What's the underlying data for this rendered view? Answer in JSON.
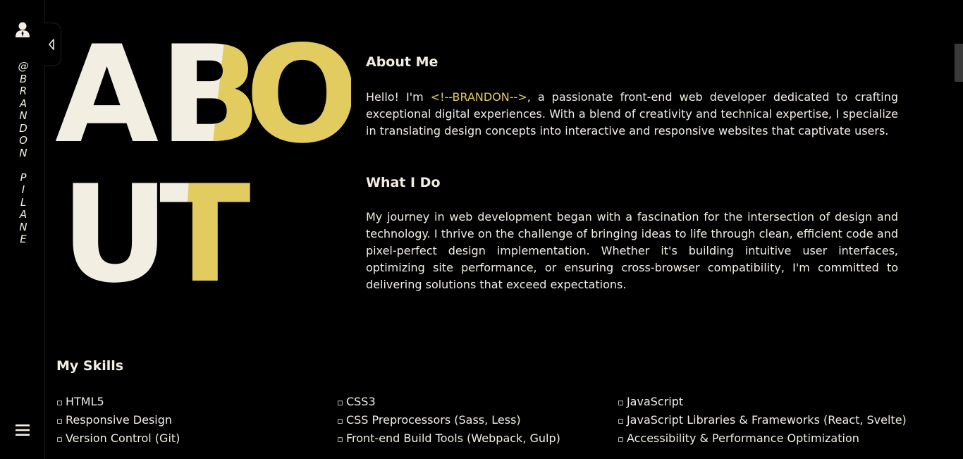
{
  "sidebar": {
    "handle": "@BRANDON PILANE",
    "icons": [
      "user-icon",
      "menu-icon",
      "collapse-arrow-icon"
    ]
  },
  "hero": {
    "word_line1": "ABO",
    "word_line2": "UT",
    "text_color": "#f2eee2",
    "accent_color": "#e2cc5f"
  },
  "about_me": {
    "heading": "About Me",
    "intro_prefix": "Hello! I'm ",
    "name_tag": "<!--BRANDON-->",
    "intro_suffix": ", a passionate front-end web developer dedicated to crafting exceptional digital experiences. With a blend of creativity and technical expertise, I specialize in translating design concepts into interactive and responsive websites that captivate users."
  },
  "what_i_do": {
    "heading": "What I Do",
    "body": "My journey in web development began with a fascination for the intersection of design and technology. I thrive on the challenge of bringing ideas to life through clean, efficient code and pixel-perfect design implementation. Whether it's building intuitive user interfaces, optimizing site performance, or ensuring cross-browser compatibility, I'm committed to delivering solutions that exceed expectations."
  },
  "skills": {
    "heading": "My Skills",
    "items": [
      "HTML5",
      "CSS3",
      "JavaScript",
      "Responsive Design",
      "CSS Preprocessors (Sass, Less)",
      "JavaScript Libraries & Frameworks (React, Svelte)",
      "Version Control (Git)",
      "Front-end Build Tools (Webpack, Gulp)",
      "Accessibility & Performance Optimization"
    ]
  }
}
